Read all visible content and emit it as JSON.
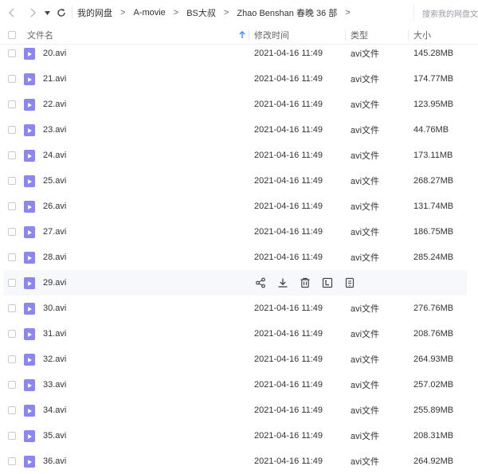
{
  "toolbar": {
    "back_icon": "chevron-left-icon",
    "forward_icon": "chevron-right-icon",
    "dropdown_icon": "caret-down-icon",
    "refresh_icon": "refresh-icon",
    "breadcrumbs": [
      "我的网盘",
      "A-movie",
      "BS大叔",
      "Zhao Benshan 春晚 36 部"
    ],
    "crumb_separator": ">",
    "search_placeholder": "搜索我的网盘文件"
  },
  "table": {
    "columns": {
      "name": "文件名",
      "modified": "修改时间",
      "type": "类型",
      "size": "大小"
    },
    "sort_icon": "arrow-up-icon",
    "sort_color": "#3a8ff5",
    "file_icon_color": "#8b86f0",
    "rows": [
      {
        "name": "20.avi",
        "modified": "2021-04-16 11:49",
        "type": "avi文件",
        "size": "145.28MB"
      },
      {
        "name": "21.avi",
        "modified": "2021-04-16 11:49",
        "type": "avi文件",
        "size": "174.77MB"
      },
      {
        "name": "22.avi",
        "modified": "2021-04-16 11:49",
        "type": "avi文件",
        "size": "123.95MB"
      },
      {
        "name": "23.avi",
        "modified": "2021-04-16 11:49",
        "type": "avi文件",
        "size": "44.76MB"
      },
      {
        "name": "24.avi",
        "modified": "2021-04-16 11:49",
        "type": "avi文件",
        "size": "173.11MB"
      },
      {
        "name": "25.avi",
        "modified": "2021-04-16 11:49",
        "type": "avi文件",
        "size": "268.27MB"
      },
      {
        "name": "26.avi",
        "modified": "2021-04-16 11:49",
        "type": "avi文件",
        "size": "131.74MB"
      },
      {
        "name": "27.avi",
        "modified": "2021-04-16 11:49",
        "type": "avi文件",
        "size": "186.75MB"
      },
      {
        "name": "28.avi",
        "modified": "2021-04-16 11:49",
        "type": "avi文件",
        "size": "285.24MB"
      },
      {
        "name": "29.avi",
        "hovered": true,
        "actions": [
          "share-icon",
          "download-icon",
          "delete-icon",
          "rename-icon",
          "more-icon"
        ]
      },
      {
        "name": "30.avi",
        "modified": "2021-04-16 11:49",
        "type": "avi文件",
        "size": "276.76MB"
      },
      {
        "name": "31.avi",
        "modified": "2021-04-16 11:49",
        "type": "avi文件",
        "size": "208.76MB"
      },
      {
        "name": "32.avi",
        "modified": "2021-04-16 11:49",
        "type": "avi文件",
        "size": "264.93MB"
      },
      {
        "name": "33.avi",
        "modified": "2021-04-16 11:49",
        "type": "avi文件",
        "size": "257.02MB"
      },
      {
        "name": "34.avi",
        "modified": "2021-04-16 11:49",
        "type": "avi文件",
        "size": "255.89MB"
      },
      {
        "name": "35.avi",
        "modified": "2021-04-16 11:49",
        "type": "avi文件",
        "size": "208.31MB"
      },
      {
        "name": "36.avi",
        "modified": "2021-04-16 11:49",
        "type": "avi文件",
        "size": "264.92MB"
      }
    ]
  }
}
